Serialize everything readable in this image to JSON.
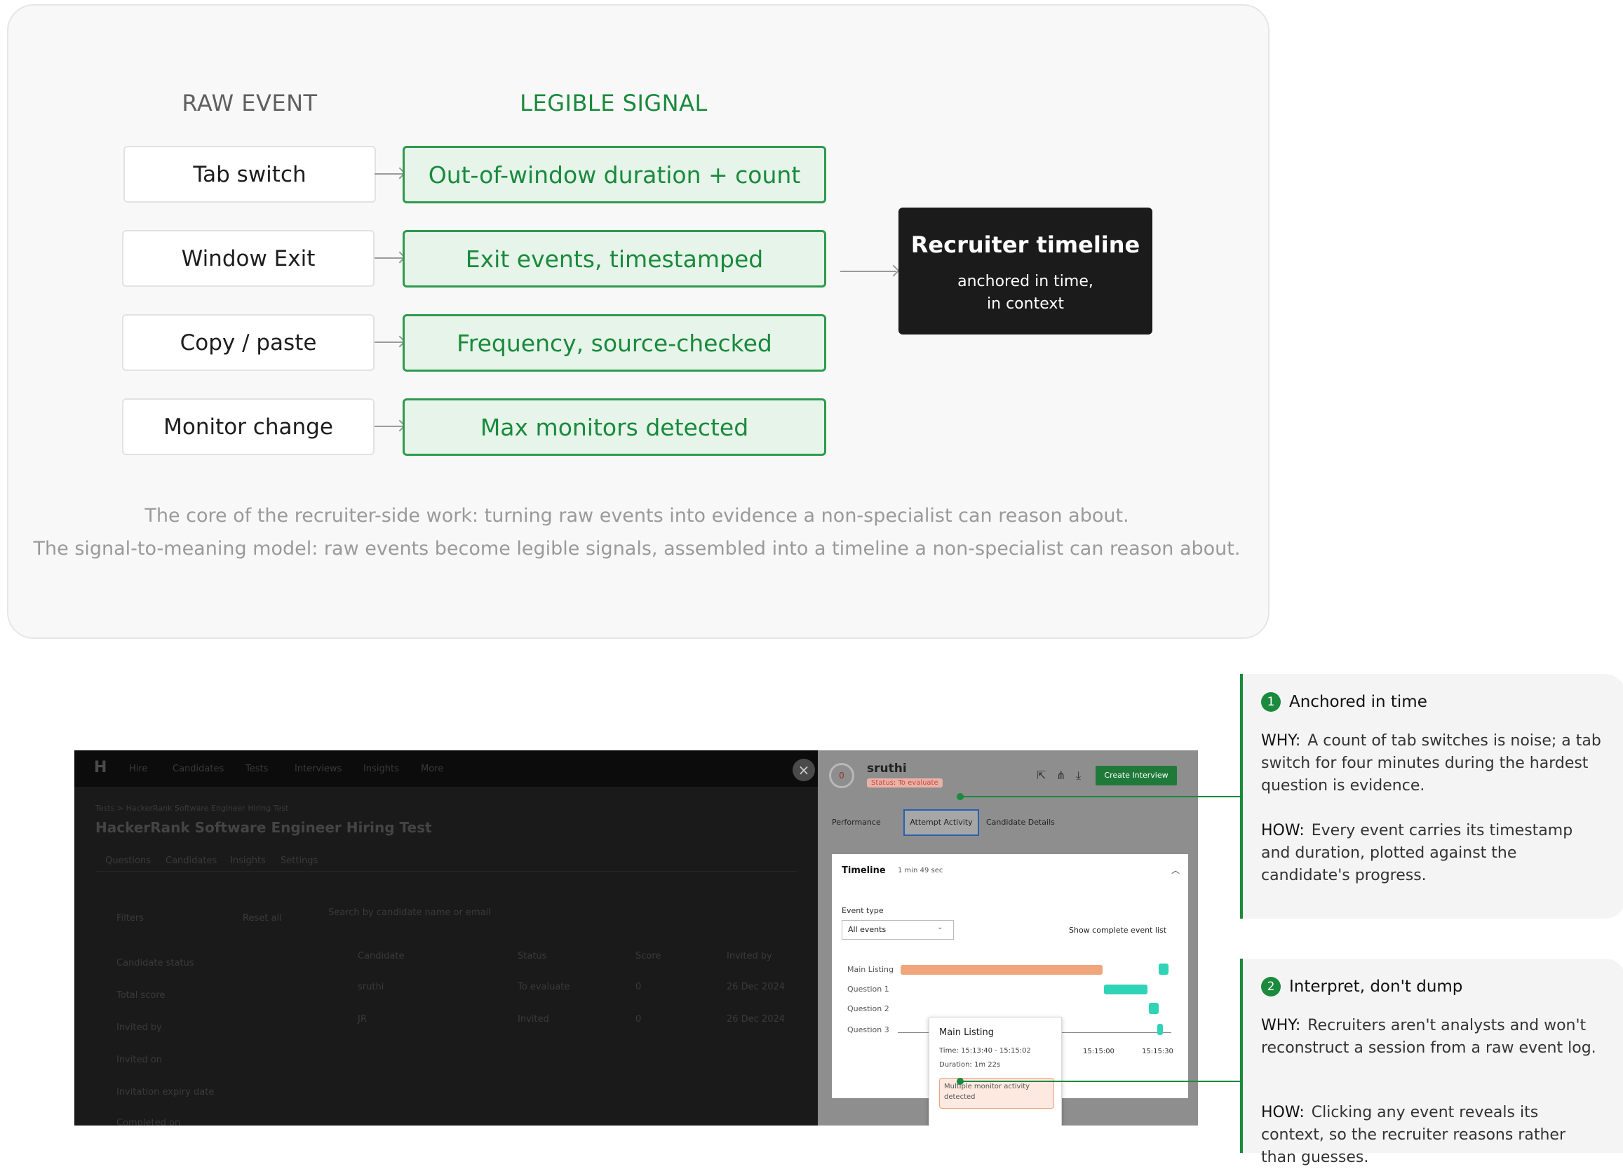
{
  "diagram": {
    "raw_header": "RAW EVENT",
    "signal_header": "LEGIBLE SIGNAL",
    "rows": [
      {
        "raw": "Tab switch",
        "signal": "Out-of-window duration + count"
      },
      {
        "raw": "Window Exit",
        "signal": "Exit events, timestamped"
      },
      {
        "raw": "Copy / paste",
        "signal": "Frequency, source-checked"
      },
      {
        "raw": "Monitor change",
        "signal": "Max monitors detected"
      }
    ],
    "output_title": "Recruiter timeline",
    "output_subtitle_line1": "anchored in time,",
    "output_subtitle_line2": "in context",
    "caption_1": "The core of the recruiter-side work: turning raw events into evidence a non-specialist can reason about.",
    "caption_2": "The signal-to-meaning model: raw events become legible signals, assembled into a timeline a non-specialist can reason about.",
    "colors": {
      "accent_green": "#1a8a3c",
      "signal_fill": "#e6f4ea",
      "output_bg": "#1b1b1b"
    }
  },
  "screenshot": {
    "app_logo": "H",
    "nav_items": [
      "Hire",
      "Candidates",
      "Tests",
      "Interviews",
      "Insights",
      "More"
    ],
    "breadcrumb": "Tests > HackerRank Software Engineer Hiring Test",
    "page_title": "HackerRank Software Engineer Hiring Test",
    "tabs": [
      "Questions",
      "Candidates",
      "Insights",
      "Settings"
    ],
    "filters_label": "Filters",
    "reset_label": "Reset all",
    "search_placeholder": "Search by candidate name or email",
    "filter_items": [
      "Candidate status",
      "Total score",
      "Invited by",
      "Invited on",
      "Invitation expiry date",
      "Completed on"
    ],
    "table_headers": [
      "Candidate",
      "Status",
      "Score",
      "Invited by"
    ],
    "table_rows": [
      {
        "name": "sruthi",
        "status": "To evaluate",
        "score": "0",
        "invited": "26 Dec 2024"
      },
      {
        "name": "JR",
        "status": "Invited",
        "score": "0",
        "invited": "26 Dec 2024"
      }
    ],
    "close_symbol": "×",
    "panel": {
      "score": "0",
      "candidate_name": "sruthi",
      "status_label": "Status: To evaluate",
      "create_interview_label": "Create Interview",
      "tabs": [
        "Performance",
        "Attempt Activity",
        "Candidate Details"
      ],
      "timeline_title": "Timeline",
      "timeline_duration": "1 min 49 sec",
      "event_type_label": "Event type",
      "event_type_value": "All events",
      "show_complete_label": "Show complete event list",
      "rows": [
        "Main Listing",
        "Question 1",
        "Question 2",
        "Question 3"
      ],
      "ticks": [
        "15:15:00",
        "15:15:30"
      ],
      "tooltip": {
        "title": "Main Listing",
        "time": "Time: 15:13:40 - 15:15:02",
        "duration": "Duration: 1m 22s",
        "alert": "Multiple monitor activity detected"
      }
    }
  },
  "notes": [
    {
      "number": "1",
      "title": "Anchored in time",
      "why_label": "WHY:",
      "why": "A count of tab switches is noise; a tab switch for four minutes during the hardest question is evidence.",
      "how_label": "HOW:",
      "how": "Every event carries its timestamp and duration, plotted against the candidate's progress."
    },
    {
      "number": "2",
      "title": "Interpret, don't dump",
      "why_label": "WHY:",
      "why": "Recruiters aren't analysts and won't reconstruct a session from a raw event log.",
      "how_label": "HOW:",
      "how": "Clicking any event reveals its context, so the recruiter reasons rather than guesses."
    }
  ]
}
